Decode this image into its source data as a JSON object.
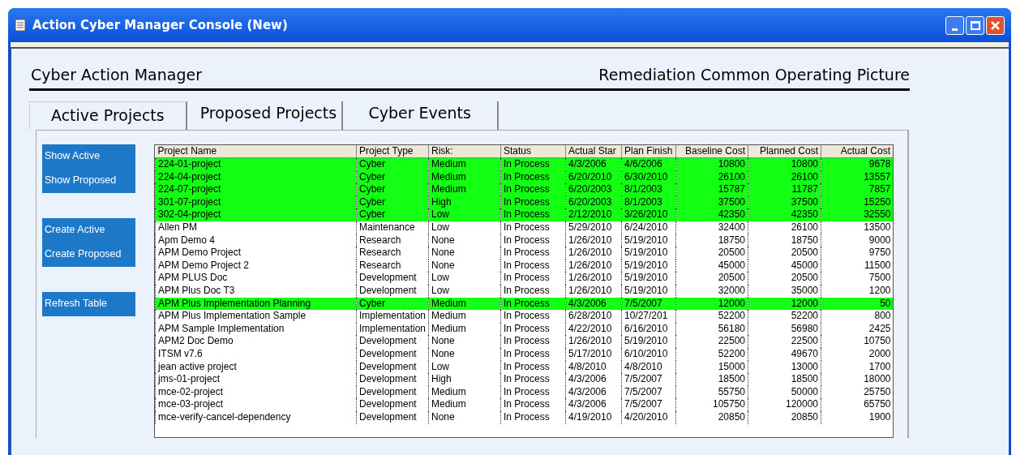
{
  "window": {
    "title": "Action Cyber Manager Console (New)"
  },
  "header": {
    "left": "Cyber Action Manager",
    "right": "Remediation Common Operating Picture"
  },
  "tabs": [
    {
      "label": "Active Projects",
      "selected": true
    },
    {
      "label": "Proposed Projects",
      "selected": false
    },
    {
      "label": "Cyber Events",
      "selected": false
    }
  ],
  "button_groups": [
    [
      "Show Active",
      "Show Proposed"
    ],
    [
      "Create Active",
      "Create Proposed"
    ],
    [
      "Refresh Table"
    ]
  ],
  "table": {
    "columns": [
      {
        "label": "Project Name",
        "kind": "text"
      },
      {
        "label": "Project Type",
        "kind": "text"
      },
      {
        "label": "Risk:",
        "kind": "text"
      },
      {
        "label": "Status",
        "kind": "text"
      },
      {
        "label": "Actual Star",
        "kind": "text"
      },
      {
        "label": "Plan Finish",
        "kind": "text"
      },
      {
        "label": "Baseline Cost",
        "kind": "number"
      },
      {
        "label": "Planned Cost",
        "kind": "number"
      },
      {
        "label": "Actual Cost",
        "kind": "number"
      }
    ],
    "rows": [
      {
        "highlighted": true,
        "cells": [
          "224-01-project",
          "Cyber",
          "Medium",
          "In Process",
          "4/3/2006",
          "4/6/2006",
          "10800",
          "10800",
          "9678"
        ]
      },
      {
        "highlighted": true,
        "cells": [
          "224-04-project",
          "Cyber",
          "Medium",
          "In Process",
          "6/20/2010",
          "6/30/2010",
          "26100",
          "26100",
          "13557"
        ]
      },
      {
        "highlighted": true,
        "cells": [
          "224-07-project",
          "Cyber",
          "Medium",
          "In Process",
          "6/20/2003",
          "8/1/2003",
          "15787",
          "11787",
          "7857"
        ]
      },
      {
        "highlighted": true,
        "cells": [
          "301-07-project",
          "Cyber",
          "High",
          "In Process",
          "6/20/2003",
          "8/1/2003",
          "37500",
          "37500",
          "15250"
        ]
      },
      {
        "highlighted": true,
        "cells": [
          "302-04-project",
          "Cyber",
          "Low",
          "In Process",
          "2/12/2010",
          "3/26/2010",
          "42350",
          "42350",
          "32550"
        ]
      },
      {
        "highlighted": false,
        "cells": [
          "Allen PM",
          "Maintenance",
          "Low",
          "In Process",
          "5/29/2010",
          "6/24/2010",
          "32400",
          "26100",
          "13500"
        ]
      },
      {
        "highlighted": false,
        "cells": [
          "Apm Demo 4",
          "Research",
          "None",
          "In Process",
          "1/26/2010",
          "5/19/2010",
          "18750",
          "18750",
          "9000"
        ]
      },
      {
        "highlighted": false,
        "cells": [
          "APM Demo Project",
          "Research",
          "None",
          "In Process",
          "1/26/2010",
          "5/19/2010",
          "20500",
          "20500",
          "9750"
        ]
      },
      {
        "highlighted": false,
        "cells": [
          "APM Demo Project 2",
          "Research",
          "None",
          "In Process",
          "1/26/2010",
          "5/19/2010",
          "45000",
          "45000",
          "11500"
        ]
      },
      {
        "highlighted": false,
        "cells": [
          "APM PLUS Doc",
          "Development",
          "Low",
          "In Process",
          "1/26/2010",
          "5/19/2010",
          "20500",
          "20500",
          "7500"
        ]
      },
      {
        "highlighted": false,
        "cells": [
          "APM Plus Doc T3",
          "Development",
          "Low",
          "In Process",
          "1/26/2010",
          "5/19/2010",
          "32000",
          "35000",
          "1200"
        ]
      },
      {
        "highlighted": true,
        "cells": [
          "APM Plus Implementation Planning",
          "Cyber",
          "Medium",
          "In Process",
          "4/3/2006",
          "7/5/2007",
          "12000",
          "12000",
          "50"
        ]
      },
      {
        "highlighted": false,
        "cells": [
          "APM Plus Implementation Sample",
          "Implementation",
          "Medium",
          "In Process",
          "6/28/2010",
          "10/27/201",
          "52200",
          "52200",
          "800"
        ]
      },
      {
        "highlighted": false,
        "cells": [
          "APM Sample Implementation",
          "Implementation",
          "Medium",
          "In Process",
          "4/22/2010",
          "6/16/2010",
          "56180",
          "56980",
          "2425"
        ]
      },
      {
        "highlighted": false,
        "cells": [
          "APM2 Doc Demo",
          "Development",
          "None",
          "In Process",
          "1/26/2010",
          "5/19/2010",
          "22500",
          "22500",
          "10750"
        ]
      },
      {
        "highlighted": false,
        "cells": [
          "ITSM v7.6",
          "Development",
          "None",
          "In Process",
          "5/17/2010",
          "6/10/2010",
          "52200",
          "49670",
          "2000"
        ]
      },
      {
        "highlighted": false,
        "cells": [
          "jean active project",
          "Development",
          "Low",
          "In Process",
          "4/8/2010",
          "4/8/2010",
          "15000",
          "13000",
          "1700"
        ]
      },
      {
        "highlighted": false,
        "cells": [
          "jms-01-project",
          "Development",
          "High",
          "In Process",
          "4/3/2006",
          "7/5/2007",
          "18500",
          "18500",
          "18000"
        ]
      },
      {
        "highlighted": false,
        "cells": [
          "mce-02-project",
          "Development",
          "Medium",
          "In Process",
          "4/3/2006",
          "7/5/2007",
          "55750",
          "50000",
          "25750"
        ]
      },
      {
        "highlighted": false,
        "cells": [
          "mce-03-project",
          "Development",
          "Medium",
          "In Process",
          "4/3/2006",
          "7/5/2007",
          "105750",
          "120000",
          "65750"
        ]
      },
      {
        "highlighted": false,
        "cells": [
          "mce-verify-cancel-dependency",
          "Development",
          "None",
          "In Process",
          "4/19/2010",
          "4/20/2010",
          "20850",
          "20850",
          "1900"
        ]
      }
    ]
  }
}
